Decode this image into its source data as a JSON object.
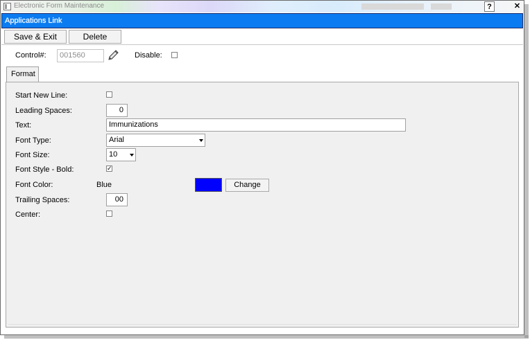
{
  "window": {
    "title": "Electronic Form Maintenance",
    "help_label": "?",
    "close_label": "✕"
  },
  "caption": "Applications Link",
  "toolbar": {
    "save_exit_label": "Save & Exit",
    "delete_label": "Delete"
  },
  "header": {
    "control_label": "Control#:",
    "control_value": "001560",
    "disable_label": "Disable:",
    "disable_checked": false
  },
  "tabs": [
    {
      "label": "Format",
      "active": true
    }
  ],
  "format": {
    "start_new_line_label": "Start New Line:",
    "start_new_line_checked": false,
    "leading_spaces_label": "Leading Spaces:",
    "leading_spaces_value": "0",
    "text_label": "Text:",
    "text_value": "Immunizations",
    "font_type_label": "Font Type:",
    "font_type_value": "Arial",
    "font_size_label": "Font Size:",
    "font_size_value": "10",
    "font_style_bold_label": "Font Style - Bold:",
    "font_style_bold_checked": true,
    "font_color_label": "Font Color:",
    "font_color_name": "Blue",
    "font_color_hex": "#0000ff",
    "change_label": "Change",
    "trailing_spaces_label": "Trailing Spaces:",
    "trailing_spaces_value": "00",
    "center_label": "Center:",
    "center_checked": false
  },
  "icons": {
    "edit": "pencil-icon",
    "app": "window-icon",
    "dropdown": "chevron-down-icon"
  },
  "colors": {
    "caption_bg": "#0a7bf0",
    "panel_bg": "#f0f0f0"
  }
}
